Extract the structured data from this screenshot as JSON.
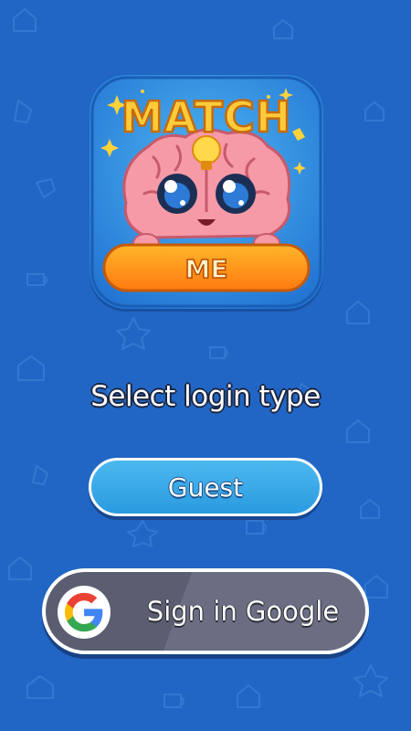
{
  "logo": {
    "title": "MATCH",
    "subtitle": "ME"
  },
  "login": {
    "prompt": "Select login type",
    "guest_label": "Guest",
    "google_label": "Sign in Google"
  },
  "colors": {
    "background": "#2166c4",
    "guest_button": "#3aa9ea",
    "google_button": "#5f6275",
    "logo_title": "#f6b52c",
    "logo_banner": "#ff9a1a"
  },
  "icons": {
    "google": "google-g-icon",
    "background_pattern": "house-star-mug-doodles"
  }
}
